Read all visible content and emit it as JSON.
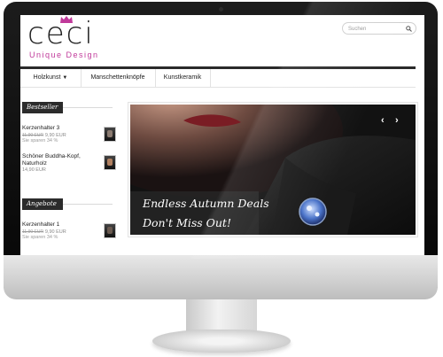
{
  "logo": {
    "name": "ceci",
    "tagline": "Unique Design"
  },
  "search": {
    "placeholder": "Suchen"
  },
  "nav": {
    "items": [
      {
        "label": "Holzkunst",
        "has_dropdown": true
      },
      {
        "label": "Manschettenknöpfe"
      },
      {
        "label": "Kunstkeramik"
      }
    ]
  },
  "sidebar": {
    "bestseller": {
      "heading": "Bestseller",
      "products": [
        {
          "name": "Kerzenhalter 3",
          "old_price": "11,90 EUR",
          "price": "9,90 EUR",
          "savings": "Sie sparen 34 %"
        },
        {
          "name": "Schöner Buddha-Kopf, Naturholz",
          "price": "14,90 EUR"
        }
      ]
    },
    "angebote": {
      "heading": "Angebote",
      "products": [
        {
          "name": "Kerzenhalter 1",
          "old_price": "11,90 EUR",
          "price": "9,90 EUR",
          "savings": "Sie sparen 34 %"
        }
      ]
    }
  },
  "slider": {
    "caption_line1": "Endless Autumn Deals",
    "caption_line2": "Don't Miss Out!",
    "prev_icon": "chevron-left-icon",
    "next_icon": "chevron-right-icon"
  },
  "colors": {
    "brand": "#c0399a",
    "nav_border": "#2a2a2a",
    "heading_bg": "#2b2b2b"
  }
}
